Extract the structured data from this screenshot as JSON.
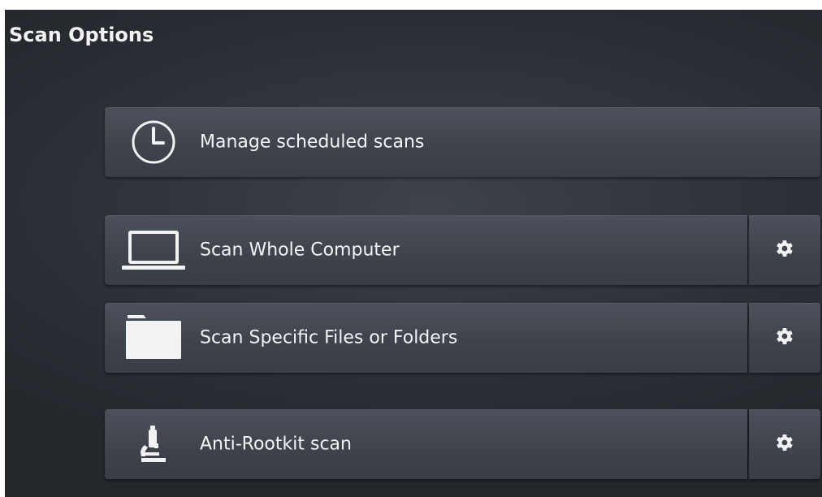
{
  "title": "Scan Options",
  "rows": [
    {
      "label": "Manage scheduled scans",
      "icon": "clock-icon",
      "has_settings": false
    },
    {
      "label": "Scan Whole Computer",
      "icon": "laptop-icon",
      "has_settings": true
    },
    {
      "label": "Scan Specific Files or Folders",
      "icon": "folder-icon",
      "has_settings": true
    },
    {
      "label": "Anti-Rootkit scan",
      "icon": "microscope-icon",
      "has_settings": true
    }
  ],
  "settings_icon": "gear-icon"
}
